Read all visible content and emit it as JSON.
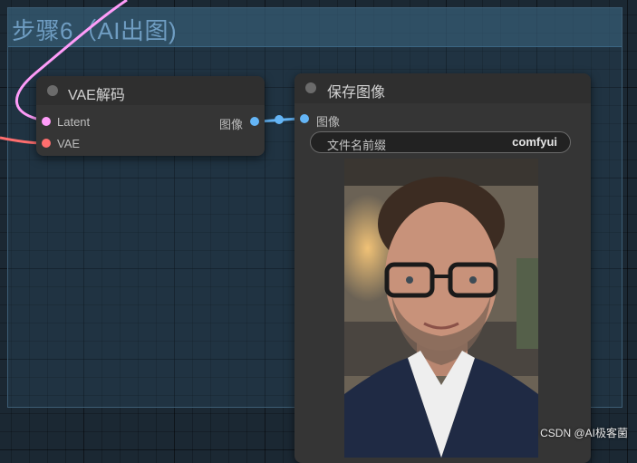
{
  "group": {
    "title": "步骤6（AI出图)"
  },
  "vae_decode_node": {
    "title": "VAE解码",
    "inputs": [
      {
        "label": "Latent",
        "color": "#ff9cf9"
      },
      {
        "label": "VAE",
        "color": "#ff6e6e"
      }
    ],
    "output": {
      "label": "图像",
      "color": "#64b5f6"
    }
  },
  "save_image_node": {
    "title": "保存图像",
    "input": {
      "label": "图像",
      "color": "#64b5f6"
    },
    "widget": {
      "name": "文件名前缀",
      "value": "comfyui"
    }
  },
  "watermark": "CSDN @AI极客菌",
  "colors": {
    "group_title": "#6f9dc2",
    "node_bg": "#353535",
    "latent_wire": "#ff9cf9",
    "vae_wire": "#ff6e6e",
    "image_wire": "#64b5f6"
  }
}
